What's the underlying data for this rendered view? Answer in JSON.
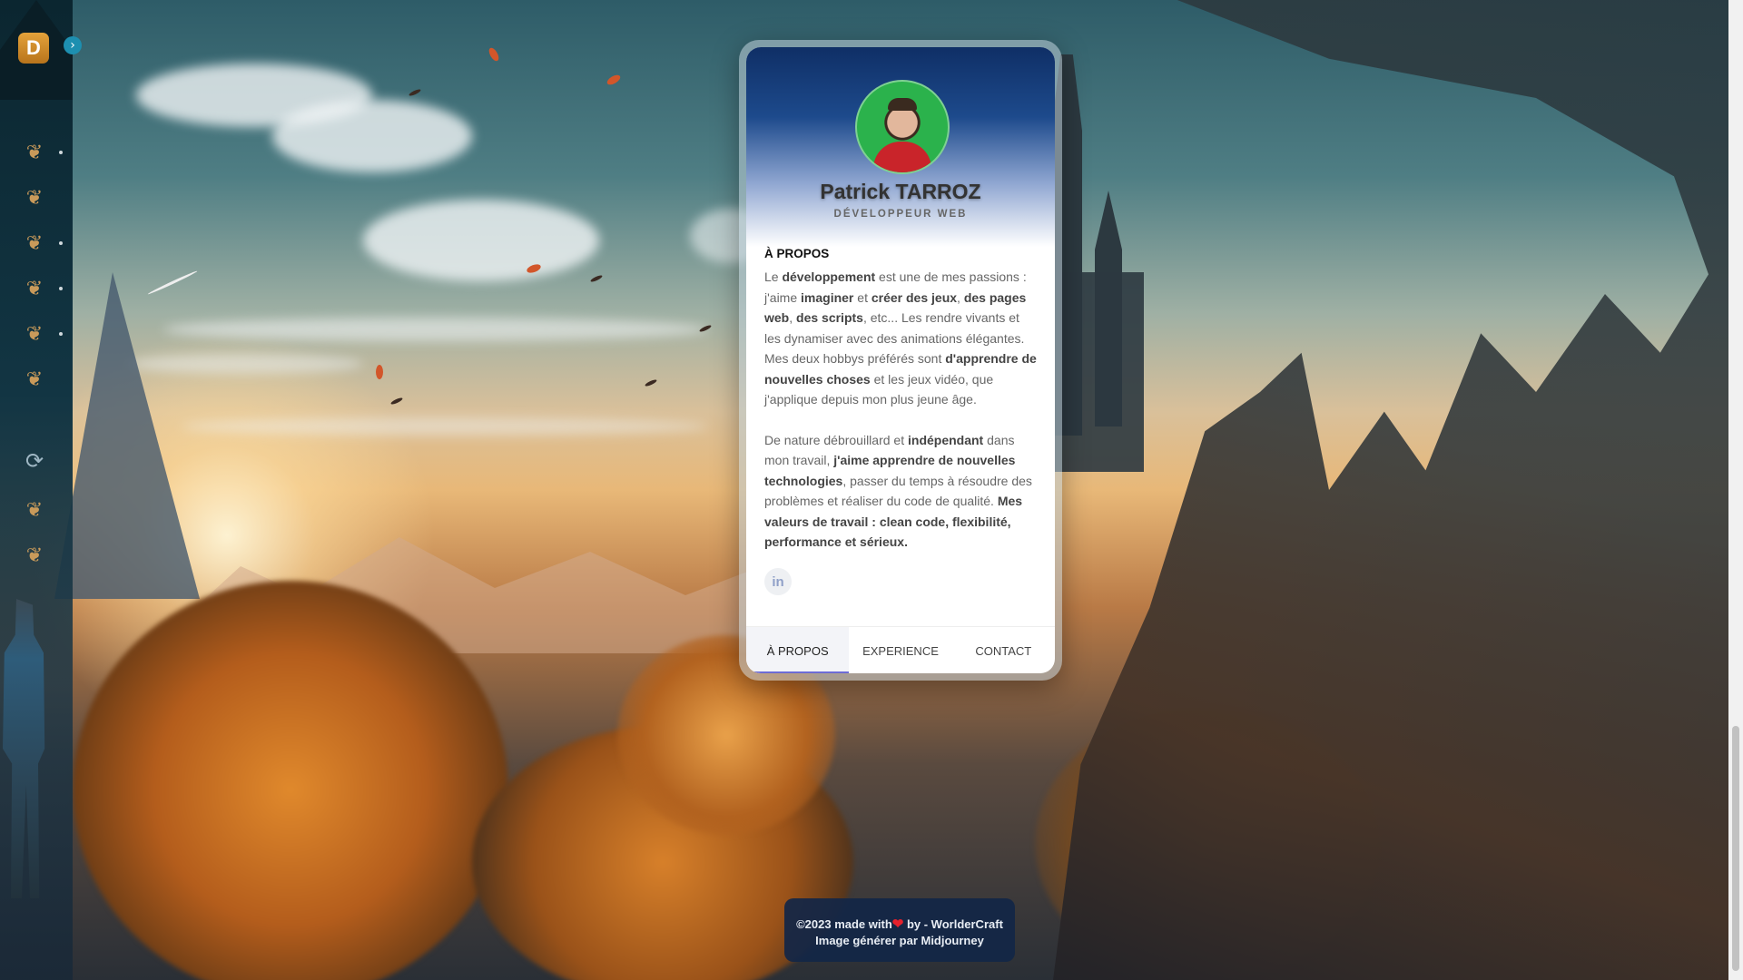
{
  "sidebar": {
    "logo_letter": "D",
    "expand_icon": "chevron-right-icon",
    "items": [
      {
        "icon": "leaf-emblem-icon",
        "has_dot": true
      },
      {
        "icon": "leaf-emblem-icon",
        "has_dot": false
      },
      {
        "icon": "leaf-emblem-icon",
        "has_dot": true
      },
      {
        "icon": "leaf-emblem-icon",
        "has_dot": true
      },
      {
        "icon": "leaf-emblem-icon",
        "has_dot": true
      },
      {
        "icon": "leaf-emblem-icon",
        "has_dot": false
      },
      {
        "icon": "refresh-icon",
        "has_dot": false
      },
      {
        "icon": "leaf-emblem-icon",
        "has_dot": false
      },
      {
        "icon": "leaf-emblem-icon",
        "has_dot": false
      }
    ]
  },
  "profile": {
    "name": "Patrick TARROZ",
    "role": "DÉVELOPPEUR WEB",
    "section_title": "À PROPOS",
    "about_p1": [
      {
        "t": "Le ",
        "b": false
      },
      {
        "t": "développement",
        "b": true
      },
      {
        "t": " est une de mes passions : j'aime ",
        "b": false
      },
      {
        "t": "imaginer",
        "b": true
      },
      {
        "t": " et ",
        "b": false
      },
      {
        "t": "créer des jeux",
        "b": true
      },
      {
        "t": ", ",
        "b": false
      },
      {
        "t": "des pages web",
        "b": true
      },
      {
        "t": ", ",
        "b": false
      },
      {
        "t": "des scripts",
        "b": true
      },
      {
        "t": ", etc... Les rendre vivants et les dynamiser avec des animations élégantes. Mes deux hobbys préférés sont ",
        "b": false
      },
      {
        "t": "d'apprendre de nouvelles choses",
        "b": true
      },
      {
        "t": " et les jeux vidéo, que j'applique depuis mon plus jeune âge.",
        "b": false
      }
    ],
    "about_p2": [
      {
        "t": "De nature débrouillard et ",
        "b": false
      },
      {
        "t": "indépendant",
        "b": true
      },
      {
        "t": " dans mon travail, ",
        "b": false
      },
      {
        "t": "j'aime apprendre de nouvelles technologies",
        "b": true
      },
      {
        "t": ", passer du temps à résoudre des problèmes et réaliser du code de qualité. ",
        "b": false
      },
      {
        "t": "Mes valeurs de travail : clean code, flexibilité, performance et sérieux.",
        "b": true
      }
    ],
    "linkedin_label": "in",
    "tabs": [
      {
        "label": "À PROPOS",
        "active": true
      },
      {
        "label": "EXPERIENCE",
        "active": false
      },
      {
        "label": "CONTACT",
        "active": false
      }
    ]
  },
  "footer": {
    "line1_before": "©2023 made with",
    "heart": "❤",
    "line1_after": " by - WorlderCraft",
    "line2": "Image générer par Midjourney"
  },
  "colors": {
    "accent": "#6d6cd6",
    "logo": "#d08a2a",
    "header_dark": "#0f2f66",
    "footer_bg": "#122646"
  }
}
